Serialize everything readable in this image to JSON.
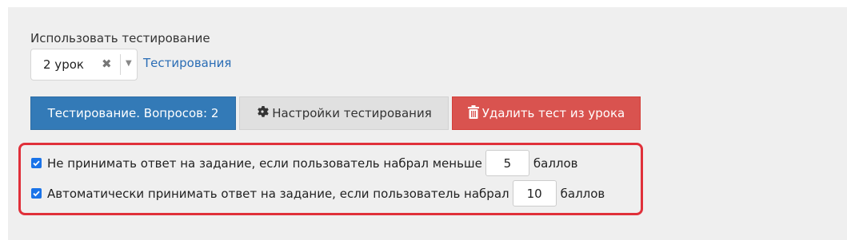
{
  "use_testing": {
    "label": "Использовать тестирование",
    "selected_lesson": "2 урок",
    "clear_symbol": "✖",
    "arrow_symbol": "▼",
    "tests_link": "Тестирования"
  },
  "buttons": {
    "testing_label": "Тестирование. Вопросов: 2",
    "settings_label": "Настройки тестирования",
    "settings_icon": "gear-icon",
    "delete_label": "Удалить тест из урока",
    "delete_icon": "trash-icon"
  },
  "options": {
    "reject_checked": true,
    "reject_text": "Не принимать ответ на задание, если пользователь набрал меньше",
    "reject_value": "5",
    "reject_unit": "баллов",
    "accept_checked": true,
    "accept_text": "Автоматически принимать ответ на задание, если пользователь набрал",
    "accept_value": "10",
    "accept_unit": "баллов"
  },
  "colors": {
    "primary": "#337ab7",
    "danger": "#d9534f",
    "highlight_border": "#e0303a",
    "link": "#2a6db5",
    "checkbox": "#1a73e8"
  }
}
